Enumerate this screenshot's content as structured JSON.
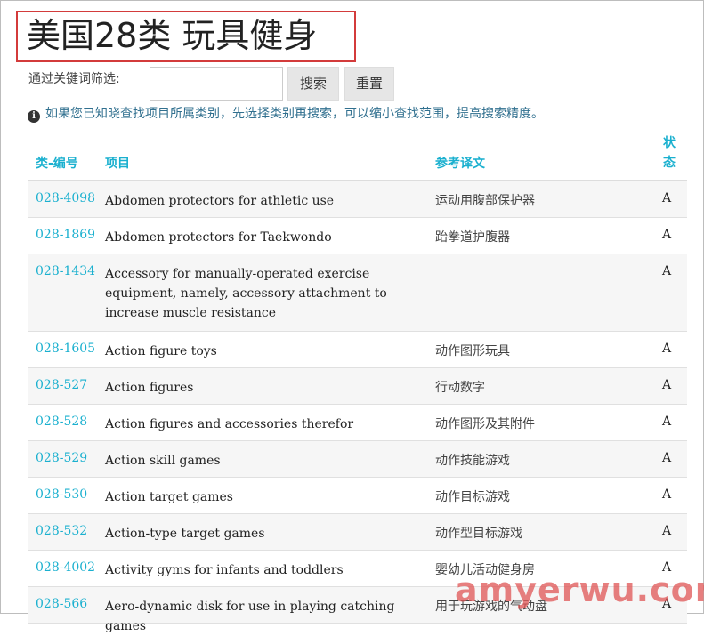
{
  "title": "美国28类 玩具健身",
  "filter": {
    "label": "通过关键词筛选:",
    "input_value": "",
    "search_label": "搜索",
    "reset_label": "重置"
  },
  "hint": "如果您已知晓查找项目所属类别，先选择类别再搜索，可以缩小查找范围，提高搜索精度。",
  "table": {
    "headers": {
      "code": "类-编号",
      "item": "项目",
      "translation": "参考译文",
      "status": "状态"
    },
    "rows": [
      {
        "code": "028-4098",
        "item": "Abdomen protectors for athletic use",
        "translation": "运动用腹部保护器",
        "status": "A"
      },
      {
        "code": "028-1869",
        "item": "Abdomen protectors for Taekwondo",
        "translation": "跆拳道护腹器",
        "status": "A"
      },
      {
        "code": "028-1434",
        "item": "Accessory for manually-operated exercise equipment, namely, accessory attachment to increase muscle resistance",
        "translation": "",
        "status": "A"
      },
      {
        "code": "028-1605",
        "item": "Action figure toys",
        "translation": "动作图形玩具",
        "status": "A"
      },
      {
        "code": "028-527",
        "item": "Action figures",
        "translation": "行动数字",
        "status": "A"
      },
      {
        "code": "028-528",
        "item": "Action figures and accessories therefor",
        "translation": "动作图形及其附件",
        "status": "A"
      },
      {
        "code": "028-529",
        "item": "Action skill games",
        "translation": "动作技能游戏",
        "status": "A"
      },
      {
        "code": "028-530",
        "item": "Action target games",
        "translation": "动作目标游戏",
        "status": "A"
      },
      {
        "code": "028-532",
        "item": "Action-type target games",
        "translation": "动作型目标游戏",
        "status": "A"
      },
      {
        "code": "028-4002",
        "item": "Activity gyms for infants and toddlers",
        "translation": "婴幼儿活动健身房",
        "status": "A"
      },
      {
        "code": "028-566",
        "item": "Aero-dynamic disk for use in playing catching games",
        "translation": "用于玩游戏的气动盘",
        "status": "A"
      }
    ]
  },
  "watermark": "amyerwu.com"
}
